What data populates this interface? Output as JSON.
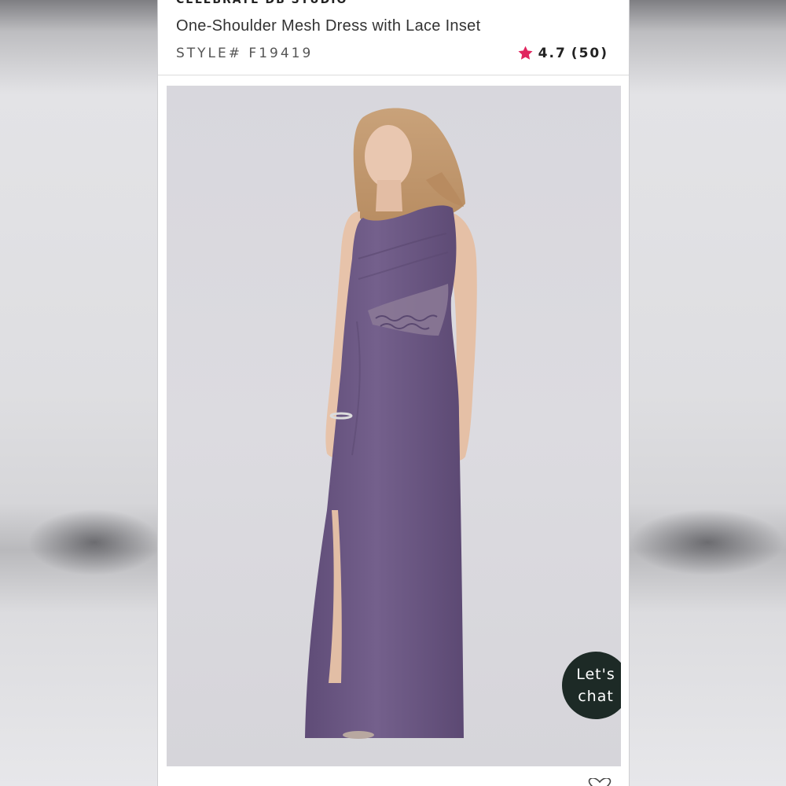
{
  "product": {
    "brand": "CELEBRATE DB STUDIO",
    "title": "One-Shoulder Mesh Dress with Lace Inset",
    "style": "STYLE# F19419",
    "rating": "4.7",
    "review_count": "(50)"
  },
  "chat": {
    "line1": "Let's",
    "line2": "chat"
  },
  "icons": {
    "rating": "star-icon",
    "favorite": "heart-icon"
  },
  "colors": {
    "star": "#e0245e",
    "chat_bg": "#1d2a26",
    "dress": "#6e5a86"
  }
}
